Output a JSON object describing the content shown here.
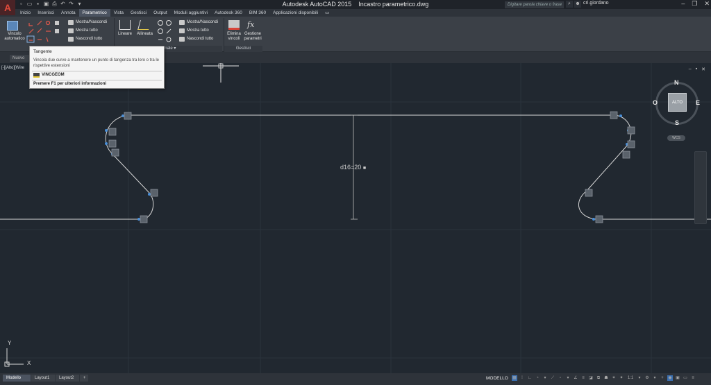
{
  "app": {
    "title": "Autodesk AutoCAD 2015",
    "document": "Incastro parametrico.dwg",
    "search_placeholder": "Digitare parola chiave o frase",
    "user": "cri.giordano"
  },
  "tabs": [
    "Inizio",
    "Inserisci",
    "Annota",
    "Parametrico",
    "Vista",
    "Gestisci",
    "Output",
    "Moduli aggiuntivi",
    "Autodesk 360",
    "BIM 360",
    "Applicazioni disponibili"
  ],
  "active_tab": "Parametrico",
  "ribbon": {
    "vincolo_automatico": "Vincolo automatico",
    "geo_show_hide": "Mostra/Nascondi",
    "geo_show_all": "Mostra tutto",
    "geo_hide_all": "Nascondi tutto",
    "dim_linear": "Lineare",
    "dim_aligned": "Allineata",
    "dim_show_hide": "Mostra/Nascondi",
    "dim_show_all": "Mostra tutto",
    "dim_hide_all": "Nascondi tutto",
    "delete_constraints": "Elimina vincoli",
    "param_manager": "Gestione parametri",
    "panel_dimensional": "ionale",
    "panel_manage": "Gestisci"
  },
  "file_tab": "Nuovo",
  "viewport_label": "[-][Alto][Wire",
  "tooltip": {
    "title": "Tangente",
    "description": "Vincola due curve a mantenere un punto di tangenza tra loro o tra le rispettive estensioni",
    "command": "VINCGEOM",
    "help": "Premere F1 per ulteriori informazioni"
  },
  "drawing": {
    "dimension_label": "d16=20"
  },
  "viewcube": {
    "face": "ALTO",
    "north": "N",
    "south": "S",
    "east": "E",
    "west": "O",
    "wcs": "WCS"
  },
  "ucs": {
    "x": "X",
    "y": "Y"
  },
  "layout_tabs": [
    "Modello",
    "Layout1",
    "Layout2"
  ],
  "status": {
    "model": "MODELLO",
    "scale": "1:1"
  },
  "colors": {
    "canvas": "#212830",
    "ribbon": "#3b4047",
    "accent": "#4a8fd8",
    "geometry": "#d8d8d8"
  }
}
